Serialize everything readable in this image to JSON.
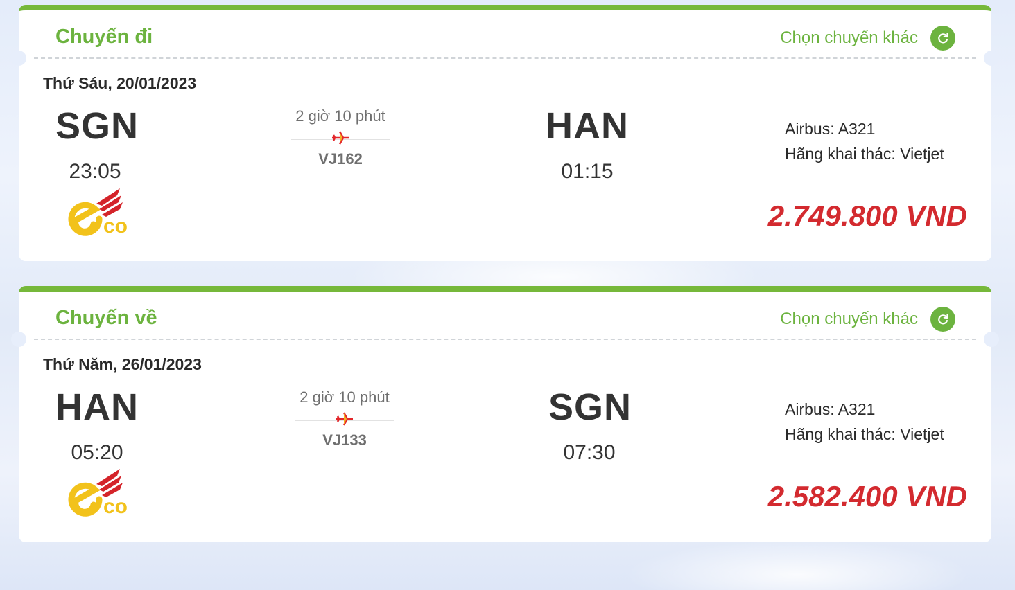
{
  "outbound": {
    "section_title": "Chuyến đi",
    "change_label": "Chọn chuyến khác",
    "date": "Thứ Sáu, 20/01/2023",
    "from_code": "SGN",
    "from_time": "23:05",
    "duration": "2 giờ 10 phút",
    "flight_number": "VJ162",
    "to_code": "HAN",
    "to_time": "01:15",
    "aircraft": "Airbus: A321",
    "operator": "Hãng khai thác: Vietjet",
    "price": "2.749.800 VND",
    "fare_class_logo": "eco"
  },
  "return": {
    "section_title": "Chuyến về",
    "change_label": "Chọn chuyến khác",
    "date": "Thứ Năm, 26/01/2023",
    "from_code": "HAN",
    "from_time": "05:20",
    "duration": "2 giờ 10 phút",
    "flight_number": "VJ133",
    "to_code": "SGN",
    "to_time": "07:30",
    "aircraft": "Airbus: A321",
    "operator": "Hãng khai thác: Vietjet",
    "price": "2.582.400 VND",
    "fare_class_logo": "eco"
  },
  "colors": {
    "accent_green": "#6cb33f",
    "price_red": "#d32a2f",
    "plane_red": "#e3262a",
    "logo_gold": "#f2c21b"
  },
  "icons": {
    "refresh": "refresh-icon",
    "plane": "plane-icon"
  }
}
